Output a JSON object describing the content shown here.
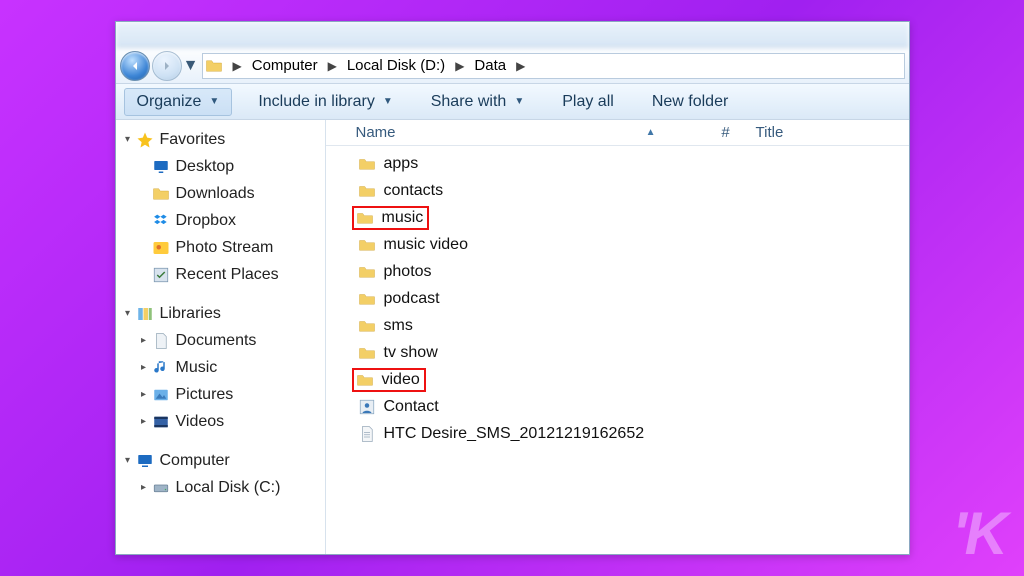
{
  "breadcrumb": {
    "segments": [
      "Computer",
      "Local Disk (D:)",
      "Data"
    ]
  },
  "toolbar": {
    "organize": "Organize",
    "include": "Include in library",
    "share": "Share with",
    "play": "Play all",
    "newfolder": "New folder"
  },
  "sidebar": {
    "favorites": {
      "label": "Favorites",
      "items": [
        "Desktop",
        "Downloads",
        "Dropbox",
        "Photo Stream",
        "Recent Places"
      ]
    },
    "libraries": {
      "label": "Libraries",
      "items": [
        "Documents",
        "Music",
        "Pictures",
        "Videos"
      ]
    },
    "computer": {
      "label": "Computer",
      "items": [
        "Local Disk (C:)"
      ]
    }
  },
  "columns": {
    "name": "Name",
    "num": "#",
    "title": "Title"
  },
  "files": [
    {
      "name": "apps",
      "type": "folder",
      "hl": false
    },
    {
      "name": "contacts",
      "type": "folder",
      "hl": false
    },
    {
      "name": "music",
      "type": "folder",
      "hl": true
    },
    {
      "name": "music video",
      "type": "folder",
      "hl": false
    },
    {
      "name": "photos",
      "type": "folder",
      "hl": false
    },
    {
      "name": "podcast",
      "type": "folder",
      "hl": false
    },
    {
      "name": "sms",
      "type": "folder",
      "hl": false
    },
    {
      "name": "tv show",
      "type": "folder",
      "hl": false
    },
    {
      "name": "video",
      "type": "folder",
      "hl": true
    },
    {
      "name": "Contact",
      "type": "contact",
      "hl": false
    },
    {
      "name": "HTC Desire_SMS_20121219162652",
      "type": "doc",
      "hl": false
    }
  ]
}
